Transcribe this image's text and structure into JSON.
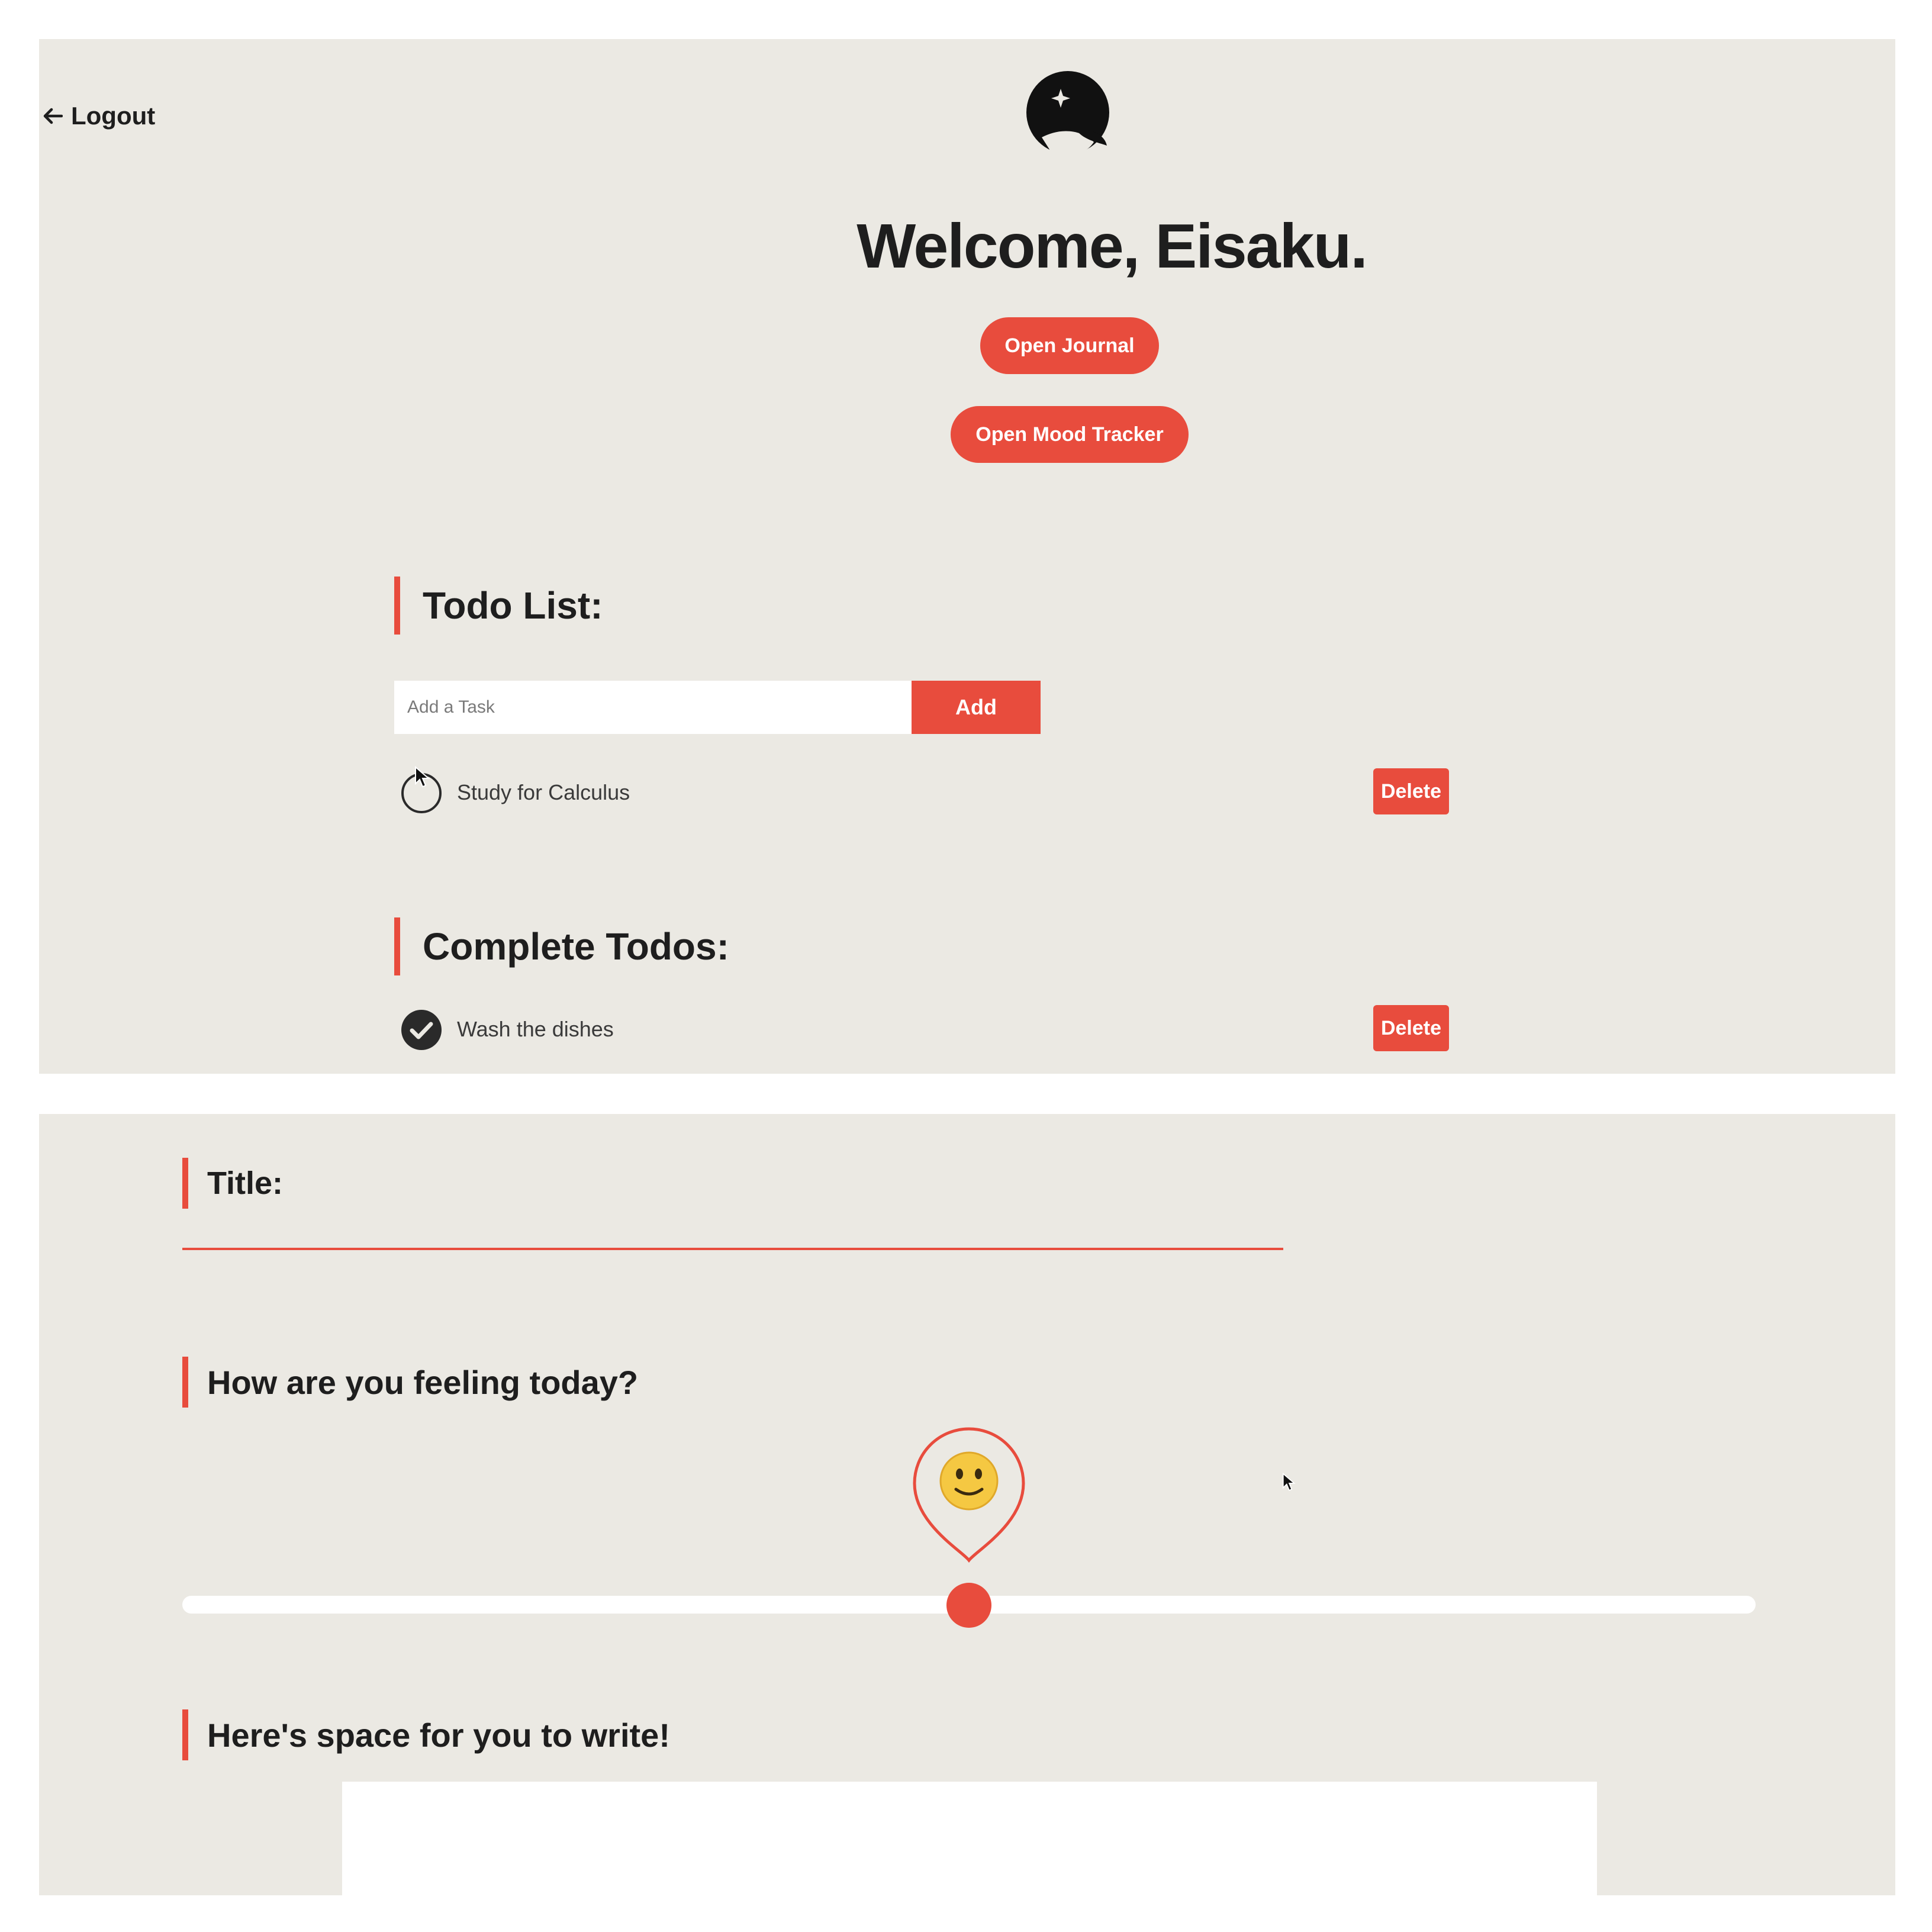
{
  "header": {
    "logout_label": "Logout",
    "welcome_text": "Welcome, Eisaku."
  },
  "actions": {
    "open_journal_label": "Open Journal",
    "open_mood_tracker_label": "Open Mood Tracker"
  },
  "todo": {
    "heading": "Todo List:",
    "input_placeholder": "Add a Task",
    "input_value": "",
    "add_label": "Add",
    "items": [
      {
        "label": "Study for Calculus",
        "completed": false,
        "delete_label": "Delete"
      }
    ]
  },
  "complete": {
    "heading": "Complete Todos:",
    "items": [
      {
        "label": "Wash the dishes",
        "completed": true,
        "delete_label": "Delete"
      }
    ]
  },
  "journal": {
    "title_heading": "Title:",
    "title_value": "",
    "feeling_heading": "How are you feeling today?",
    "mood_emoji": "🙂",
    "mood_value": 0.5,
    "write_heading": "Here's space for you to write!",
    "write_value": ""
  },
  "colors": {
    "accent": "#e84c3d",
    "background": "#ebe9e3",
    "text": "#1e1e1e",
    "surface": "#ffffff"
  },
  "icons": {
    "logout": "arrow-left-icon",
    "logo": "moon-star-logo",
    "pending": "circle-outline-icon",
    "done": "check-circle-icon",
    "mood_pin": "map-pin-icon"
  }
}
